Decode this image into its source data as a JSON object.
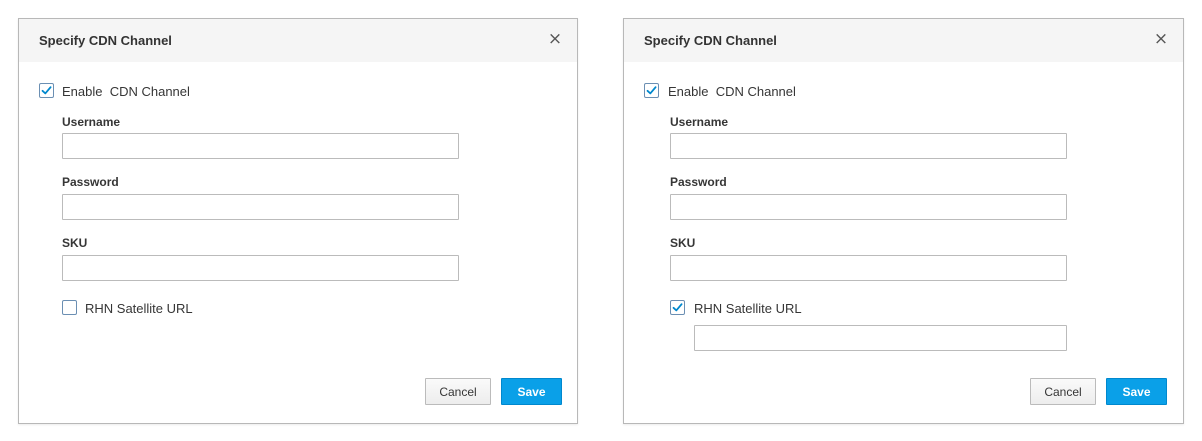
{
  "dialogs": [
    {
      "title": "Specify CDN Channel",
      "close_glyph": "×",
      "enable_cdn": {
        "label": "Enable  CDN Channel",
        "checked": true
      },
      "username": {
        "label": "Username",
        "value": ""
      },
      "password": {
        "label": "Password",
        "value": ""
      },
      "sku": {
        "label": "SKU",
        "value": ""
      },
      "rhn_satellite": {
        "label": "RHN Satellite URL",
        "checked": false
      },
      "cancel_label": "Cancel",
      "save_label": "Save"
    },
    {
      "title": "Specify CDN Channel",
      "close_glyph": "×",
      "enable_cdn": {
        "label": "Enable  CDN Channel",
        "checked": true
      },
      "username": {
        "label": "Username",
        "value": ""
      },
      "password": {
        "label": "Password",
        "value": ""
      },
      "sku": {
        "label": "SKU",
        "value": ""
      },
      "rhn_satellite": {
        "label": "RHN Satellite URL",
        "checked": true,
        "url_value": ""
      },
      "cancel_label": "Cancel",
      "save_label": "Save"
    }
  ],
  "colors": {
    "checkmark": "#0088ce",
    "save_button": "#0aa0e8",
    "header_bg": "#f5f5f5"
  },
  "icons": {
    "close": "close-icon",
    "check": "checkmark-icon"
  }
}
